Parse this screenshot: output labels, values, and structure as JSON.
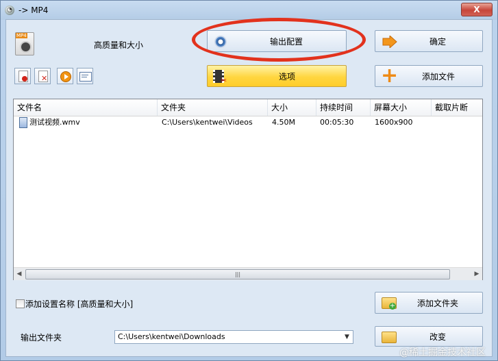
{
  "window": {
    "title": "-> MP4",
    "close_label": "X"
  },
  "profile": {
    "label": "高质量和大小",
    "icon_text": "MP4"
  },
  "buttons": {
    "output_config": "输出配置",
    "ok": "确定",
    "options": "选项",
    "add_file": "添加文件",
    "add_folder": "添加文件夹",
    "change": "改变"
  },
  "toolbar": [
    {
      "name": "remove-icon"
    },
    {
      "name": "clear-icon"
    },
    {
      "name": "play-icon"
    },
    {
      "name": "info-icon"
    }
  ],
  "list": {
    "columns": [
      "文件名",
      "文件夹",
      "大小",
      "持续时间",
      "屏幕大小",
      "截取片断"
    ],
    "rows": [
      {
        "name": "测试视频.wmv",
        "folder": "C:\\Users\\kentwei\\Videos",
        "size": "4.50M",
        "duration": "00:05:30",
        "screen": "1600x900",
        "clip": ""
      }
    ]
  },
  "options": {
    "add_setting_name": "添加设置名称 [高质量和大小]",
    "add_setting_checked": false
  },
  "output": {
    "label": "输出文件夹",
    "folder": "C:\\Users\\kentwei\\Downloads"
  },
  "watermark": "@稀土掘金技术社区",
  "colors": {
    "annotation_circle": "#e2321d",
    "accent_orange": "#ee8b17"
  }
}
